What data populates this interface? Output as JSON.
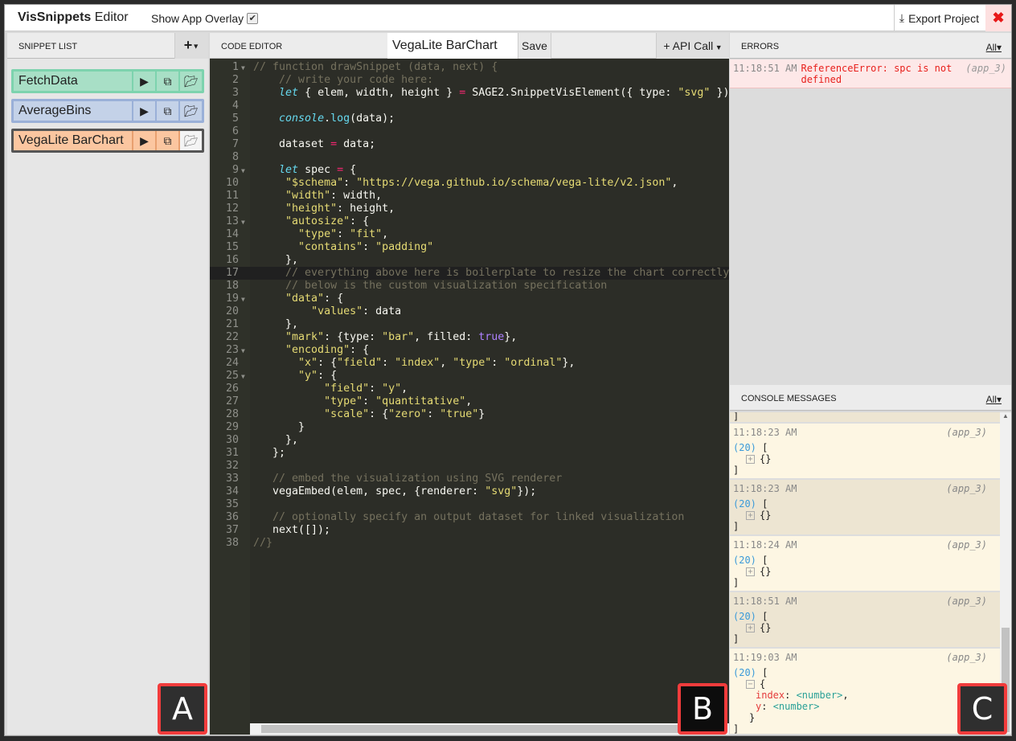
{
  "titlebar": {
    "title_bold": "VisSnippets",
    "title_rest": " Editor",
    "overlay_label": "Show App Overlay",
    "overlay_checked": true,
    "export_label": "Export Project",
    "close_icon": "close-x"
  },
  "snippet_list": {
    "header": "SNIPPET LIST",
    "add_icon": "plus",
    "items": [
      {
        "name": "FetchData",
        "bg": "#a8dfc6",
        "border": "#7dd3ae"
      },
      {
        "name": "AverageBins",
        "bg": "#c4d2e8",
        "border": "#9ab0d8"
      },
      {
        "name": "VegaLite BarChart",
        "bg": "#fbc6a0",
        "border": "#555555"
      }
    ]
  },
  "code_editor": {
    "header": "CODE EDITOR",
    "snippet_name": "VegaLite BarChart",
    "save_label": "Save",
    "api_label": "API Call",
    "lines": [
      [
        [
          "c",
          "// function drawSnippet (data, next) {"
        ]
      ],
      [
        [
          "p",
          "    "
        ],
        [
          "c",
          "// write your code here:"
        ]
      ],
      [
        [
          "p",
          "    "
        ],
        [
          "k",
          "let"
        ],
        [
          "p",
          " { elem, width, height } "
        ],
        [
          "o",
          "="
        ],
        [
          "p",
          " SAGE2.SnippetVisElement({ type: "
        ],
        [
          "s",
          "\"svg\""
        ],
        [
          "p",
          " })"
        ]
      ],
      [],
      [
        [
          "p",
          "    "
        ],
        [
          "f",
          "console"
        ],
        [
          "p",
          "."
        ],
        [
          "m",
          "log"
        ],
        [
          "p",
          "(data);"
        ]
      ],
      [],
      [
        [
          "p",
          "    dataset "
        ],
        [
          "o",
          "="
        ],
        [
          "p",
          " data;"
        ]
      ],
      [],
      [
        [
          "p",
          "    "
        ],
        [
          "k",
          "let"
        ],
        [
          "p",
          " spec "
        ],
        [
          "o",
          "="
        ],
        [
          "p",
          " {"
        ]
      ],
      [
        [
          "p",
          "     "
        ],
        [
          "s",
          "\"$schema\""
        ],
        [
          "p",
          ": "
        ],
        [
          "s",
          "\"https://vega.github.io/schema/vega-lite/v2.json\""
        ],
        [
          "p",
          ","
        ]
      ],
      [
        [
          "p",
          "     "
        ],
        [
          "s",
          "\"width\""
        ],
        [
          "p",
          ": width,"
        ]
      ],
      [
        [
          "p",
          "     "
        ],
        [
          "s",
          "\"height\""
        ],
        [
          "p",
          ": height,"
        ]
      ],
      [
        [
          "p",
          "     "
        ],
        [
          "s",
          "\"autosize\""
        ],
        [
          "p",
          ": {"
        ]
      ],
      [
        [
          "p",
          "       "
        ],
        [
          "s",
          "\"type\""
        ],
        [
          "p",
          ": "
        ],
        [
          "s",
          "\"fit\""
        ],
        [
          "p",
          ","
        ]
      ],
      [
        [
          "p",
          "       "
        ],
        [
          "s",
          "\"contains\""
        ],
        [
          "p",
          ": "
        ],
        [
          "s",
          "\"padding\""
        ]
      ],
      [
        [
          "p",
          "     },"
        ]
      ],
      [
        [
          "p",
          "     "
        ],
        [
          "c",
          "// everything above here is boilerplate to resize the chart correctly"
        ]
      ],
      [
        [
          "p",
          "     "
        ],
        [
          "c",
          "// below is the custom visualization specification"
        ]
      ],
      [
        [
          "p",
          "     "
        ],
        [
          "s",
          "\"data\""
        ],
        [
          "p",
          ": {"
        ]
      ],
      [
        [
          "p",
          "         "
        ],
        [
          "s",
          "\"values\""
        ],
        [
          "p",
          ": data"
        ]
      ],
      [
        [
          "p",
          "     },"
        ]
      ],
      [
        [
          "p",
          "     "
        ],
        [
          "s",
          "\"mark\""
        ],
        [
          "p",
          ": {type: "
        ],
        [
          "s",
          "\"bar\""
        ],
        [
          "p",
          ", filled: "
        ],
        [
          "b",
          "true"
        ],
        [
          "p",
          "},"
        ]
      ],
      [
        [
          "p",
          "     "
        ],
        [
          "s",
          "\"encoding\""
        ],
        [
          "p",
          ": {"
        ]
      ],
      [
        [
          "p",
          "       "
        ],
        [
          "s",
          "\"x\""
        ],
        [
          "p",
          ": {"
        ],
        [
          "s",
          "\"field\""
        ],
        [
          "p",
          ": "
        ],
        [
          "s",
          "\"index\""
        ],
        [
          "p",
          ", "
        ],
        [
          "s",
          "\"type\""
        ],
        [
          "p",
          ": "
        ],
        [
          "s",
          "\"ordinal\""
        ],
        [
          "p",
          "},"
        ]
      ],
      [
        [
          "p",
          "       "
        ],
        [
          "s",
          "\"y\""
        ],
        [
          "p",
          ": {"
        ]
      ],
      [
        [
          "p",
          "           "
        ],
        [
          "s",
          "\"field\""
        ],
        [
          "p",
          ": "
        ],
        [
          "s",
          "\"y\""
        ],
        [
          "p",
          ","
        ]
      ],
      [
        [
          "p",
          "           "
        ],
        [
          "s",
          "\"type\""
        ],
        [
          "p",
          ": "
        ],
        [
          "s",
          "\"quantitative\""
        ],
        [
          "p",
          ","
        ]
      ],
      [
        [
          "p",
          "           "
        ],
        [
          "s",
          "\"scale\""
        ],
        [
          "p",
          ": {"
        ],
        [
          "s",
          "\"zero\""
        ],
        [
          "p",
          ": "
        ],
        [
          "s",
          "\"true\""
        ],
        [
          "p",
          "}"
        ]
      ],
      [
        [
          "p",
          "       }"
        ]
      ],
      [
        [
          "p",
          "     },"
        ]
      ],
      [
        [
          "p",
          "   };"
        ]
      ],
      [],
      [
        [
          "p",
          "   "
        ],
        [
          "c",
          "// embed the visualization using SVG renderer"
        ]
      ],
      [
        [
          "p",
          "   vegaEmbed(elem, spec, {renderer: "
        ],
        [
          "s",
          "\"svg\""
        ],
        [
          "p",
          "});"
        ]
      ],
      [],
      [
        [
          "p",
          "   "
        ],
        [
          "c",
          "// optionally specify an output dataset for linked visualization"
        ]
      ],
      [
        [
          "p",
          "   next([]);"
        ]
      ],
      [
        [
          "c",
          "//}"
        ]
      ]
    ],
    "foldable_lines": [
      1,
      9,
      13,
      19,
      23,
      25
    ],
    "active_line": 17
  },
  "errors": {
    "header": "ERRORS",
    "filter": "All▾",
    "items": [
      {
        "time": "11:18:51 AM",
        "message": "ReferenceError: spc is not defined",
        "source": "(app_3)"
      }
    ]
  },
  "console": {
    "header": "CONSOLE MESSAGES",
    "filter": "All▾",
    "items": [
      {
        "time": "11:18:23 AM",
        "source": "(app_3)",
        "count": "(20)",
        "expanded": false
      },
      {
        "time": "11:18:23 AM",
        "source": "(app_3)",
        "count": "(20)",
        "expanded": false
      },
      {
        "time": "11:18:24 AM",
        "source": "(app_3)",
        "count": "(20)",
        "expanded": false
      },
      {
        "time": "11:18:51 AM",
        "source": "(app_3)",
        "count": "(20)",
        "expanded": false
      },
      {
        "time": "11:19:03 AM",
        "source": "(app_3)",
        "count": "(20)",
        "expanded": true,
        "fields": [
          {
            "key": "index",
            "value": "<number>"
          },
          {
            "key": "y",
            "value": "<number>"
          }
        ]
      }
    ]
  },
  "labels": [
    "A",
    "B",
    "C"
  ]
}
